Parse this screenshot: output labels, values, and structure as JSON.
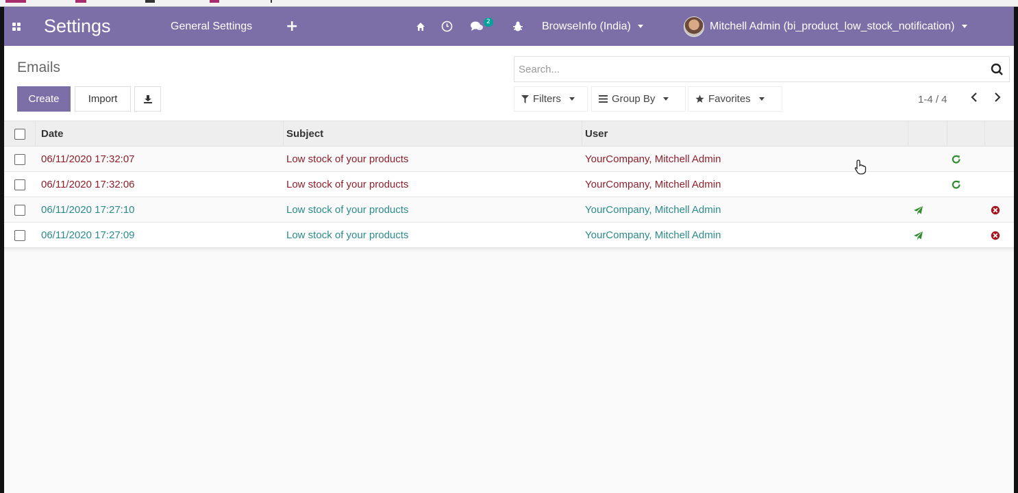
{
  "navbar": {
    "app_title": "Settings",
    "menu_general": "General Settings",
    "menu_plus": "+",
    "messages_badge": "2",
    "company": "BrowseInfo (India)",
    "user": "Mitchell Admin (bi_product_low_stock_notification)"
  },
  "control_panel": {
    "breadcrumb": "Emails",
    "create_label": "Create",
    "import_label": "Import",
    "search_placeholder": "Search...",
    "filters_label": "Filters",
    "groupby_label": "Group By",
    "favorites_label": "Favorites",
    "pager_value": "1-4 / 4"
  },
  "table": {
    "headers": [
      "Date",
      "Subject",
      "User"
    ],
    "rows": [
      {
        "date": "06/11/2020 17:32:07",
        "subject": "Low stock of your products",
        "user": "YourCompany, Mitchell Admin",
        "status": "exception"
      },
      {
        "date": "06/11/2020 17:32:06",
        "subject": "Low stock of your products",
        "user": "YourCompany, Mitchell Admin",
        "status": "exception"
      },
      {
        "date": "06/11/2020 17:27:10",
        "subject": "Low stock of your products",
        "user": "YourCompany, Mitchell Admin",
        "status": "outgoing"
      },
      {
        "date": "06/11/2020 17:27:09",
        "subject": "Low stock of your products",
        "user": "YourCompany, Mitchell Admin",
        "status": "outgoing"
      }
    ]
  },
  "colors": {
    "navbar": "#7c6fa8",
    "exception_text": "#8e1f2a",
    "outgoing_text": "#2b8a8a",
    "retry_icon": "#2e8b2e",
    "send_icon": "#2e8b2e",
    "cancel_icon": "#a4161f"
  },
  "icons": {
    "apps": "apps-grid-icon",
    "home": "home-icon",
    "clock": "clock-icon",
    "chat": "chat-icon",
    "bug": "bug-icon",
    "search": "search-icon",
    "download": "download-icon",
    "filter": "filter-icon",
    "groupby": "list-icon",
    "favorites": "star-icon",
    "retry": "retry-icon",
    "send": "send-icon",
    "cancel": "cancel-icon"
  }
}
